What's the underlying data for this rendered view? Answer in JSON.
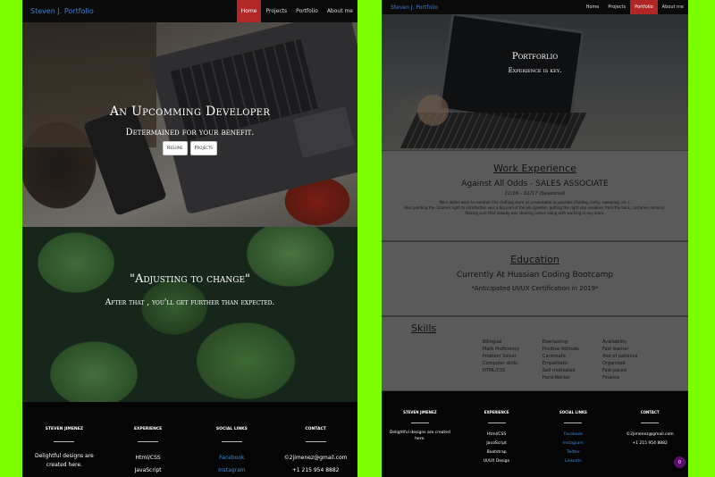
{
  "left": {
    "nav": {
      "brand": "Steven J. Portfolio",
      "links": [
        "Home",
        "Projects",
        "Portfolio",
        "About me"
      ],
      "active": "Home"
    },
    "hero": {
      "title": "An Upcomming Developer",
      "subtitle": "Determained for your benefit.",
      "buttons": [
        "Resume",
        "Projects"
      ]
    },
    "quote": {
      "title": "\"Adjusting to change\"",
      "subtitle": "After that , you'll get further than expected."
    },
    "footer": {
      "col1": {
        "heading": "STEVEN JIMENEZ",
        "description": "Delightful designs are created here."
      },
      "col2": {
        "heading": "EXPERIENCE",
        "items": [
          "Html/CSS",
          "JavaScript"
        ]
      },
      "col3": {
        "heading": "SOCIAL LINKS",
        "items": [
          "Facebook",
          "Instagram"
        ]
      },
      "col4": {
        "heading": "CONTACT",
        "items": [
          "©2jimenez@gmail.com",
          "+1 215 954 8882"
        ]
      }
    }
  },
  "right": {
    "nav": {
      "brand": "Steven J. Portfolio",
      "links": [
        "Home",
        "Projects",
        "Portfolio",
        "About me"
      ],
      "active": "Portfolio"
    },
    "hero": {
      "title": "Portforlio",
      "subtitle": "Experience is key."
    },
    "work": {
      "heading": "Work Experience",
      "company": "Against All Odds - SALES ASSOCIATE",
      "dates": "11/16 - 01/17 (Seasonal)",
      "description": [
        "Main duties were to maintain the clothing store as presentable as possible (Folding cloths, sweeping, etc.).",
        "Also pointing the cutomer right to satisfaction was a big part of the job (greeter, getting the right size sneakers from the back, customer service).",
        "Making sure that nobody was stealing comes along with working in any store."
      ]
    },
    "education": {
      "heading": "Education",
      "school": "Currently At Hussian Coding Bootcamp",
      "note": "*Anticipated UI/UX Certification in 2019*"
    },
    "skills": {
      "heading": "Skills",
      "columns": [
        [
          "Bilingual",
          "Math Proficiency",
          "Problem Solver",
          "Computer skills",
          "HTML/CSS"
        ],
        [
          "Everlasting",
          "Positive Attitude",
          "Carismatic",
          "Empathetic",
          "Self motivated",
          "Hard-Worker"
        ],
        [
          "Availability",
          "Fast learner",
          "Alot of patience",
          "Organized",
          "Fast-paced",
          "Finance"
        ]
      ]
    },
    "footer": {
      "col1": {
        "heading": "STEVEN JIMENEZ",
        "description": "Delightful designs are created here."
      },
      "col2": {
        "heading": "EXPERIENCE",
        "items": [
          "Html/CSS",
          "JavaScript",
          "Bootstrap",
          "UI/UX Design"
        ]
      },
      "col3": {
        "heading": "SOCIAL LINKS",
        "items": [
          "Facebook",
          "Instagram",
          "Twitter",
          "LinkedIn"
        ]
      },
      "col4": {
        "heading": "CONTACT",
        "items": [
          "©2jimenez@gmail.com",
          "+1 215 954 8882"
        ]
      }
    },
    "fab_label": "0"
  },
  "colors": {
    "background": "#7bff00",
    "nav_active": "#b32626",
    "brand": "#3e7fd1",
    "link": "#3e8de0",
    "section_gray": "#5a5a5a",
    "fab": "#5b0e6b"
  }
}
